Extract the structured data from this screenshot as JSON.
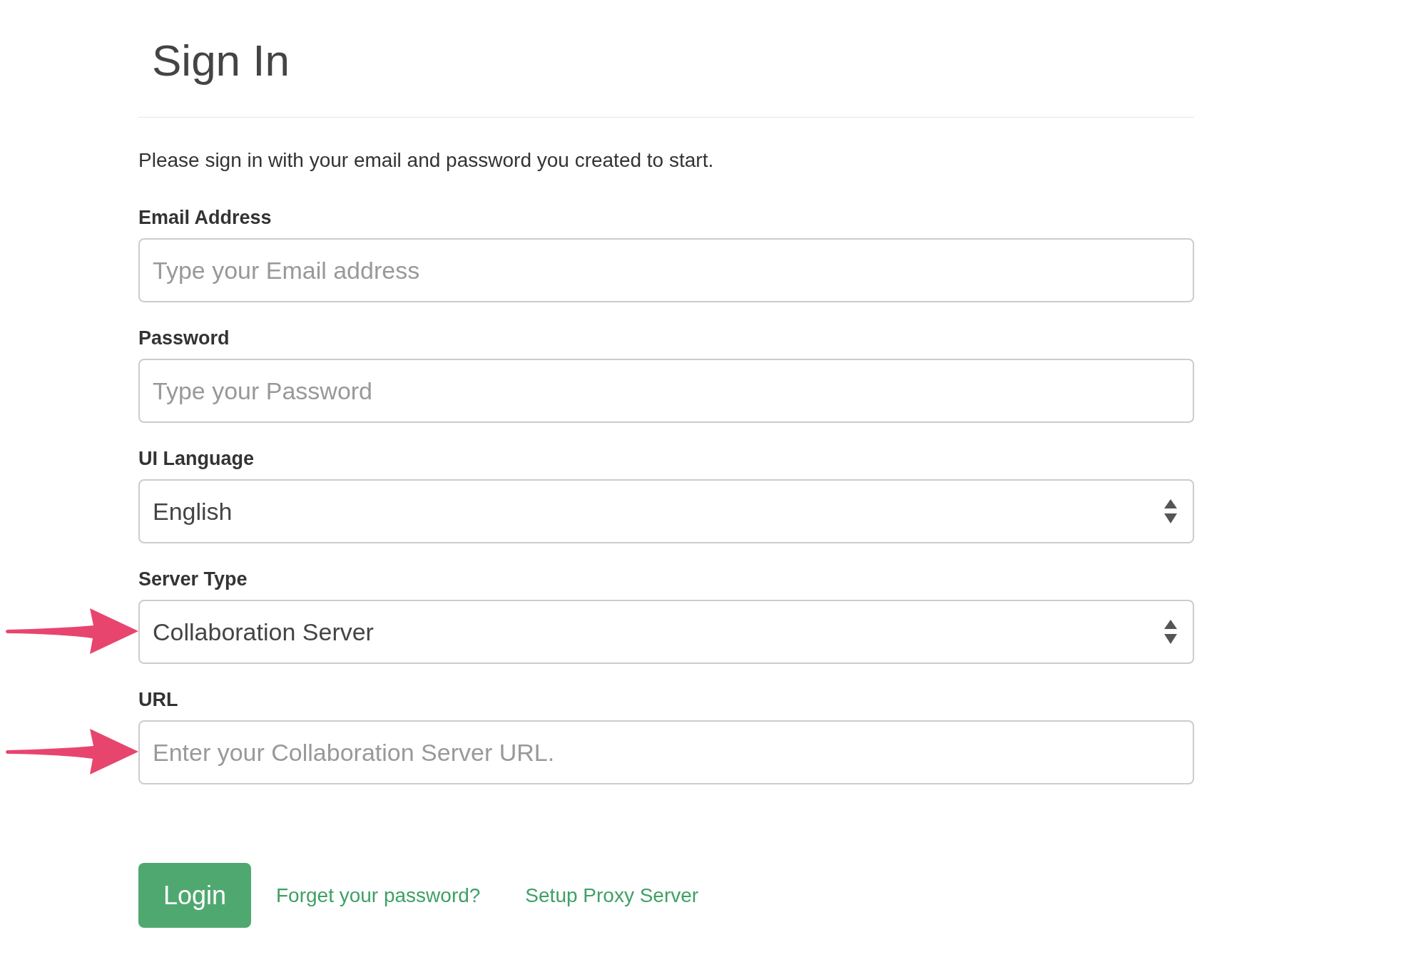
{
  "title": "Sign In",
  "intro": "Please sign in with your email and password you created to start.",
  "fields": [
    {
      "kind": "input",
      "label": "Email Address",
      "placeholder": "Type your Email address",
      "marked": false
    },
    {
      "kind": "input",
      "label": "Password",
      "placeholder": "Type your Password",
      "marked": false
    },
    {
      "kind": "select",
      "label": "UI Language",
      "value": "English",
      "marked": false
    },
    {
      "kind": "select",
      "label": "Server Type",
      "value": "Collaboration Server",
      "marked": true
    },
    {
      "kind": "input",
      "label": "URL",
      "placeholder": "Enter your Collaboration Server URL.",
      "marked": true
    }
  ],
  "login_button": "Login",
  "links": [
    "Forget your password?",
    "Setup Proxy Server"
  ]
}
